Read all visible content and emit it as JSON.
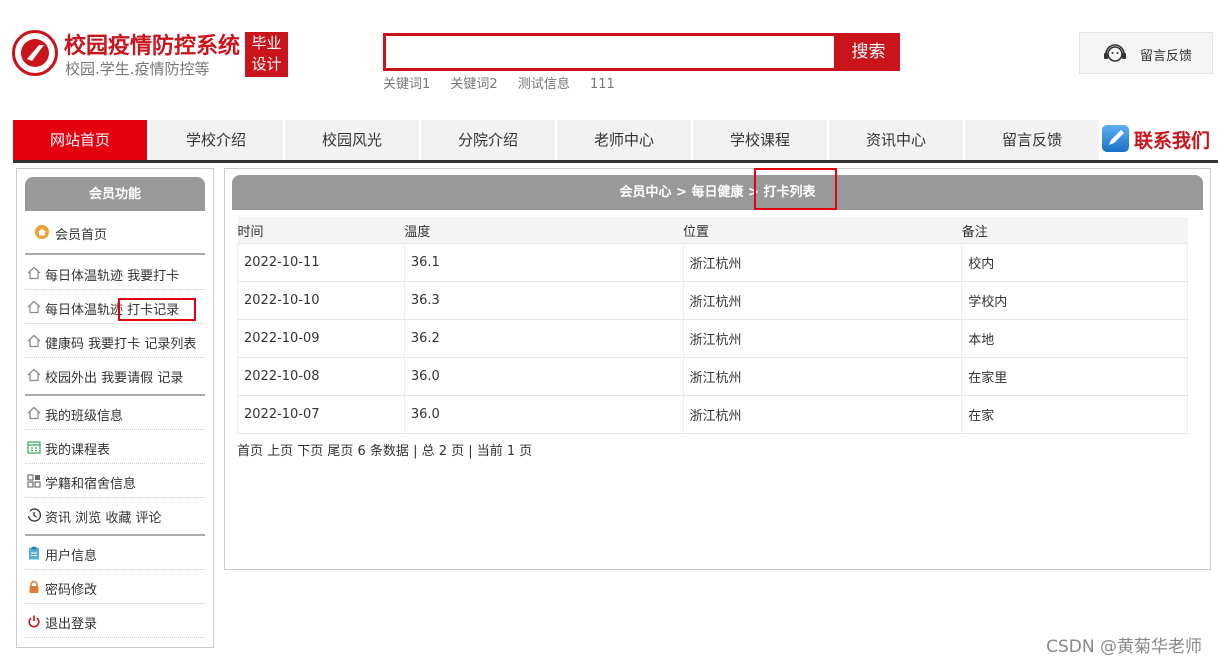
{
  "brand": {
    "title": "校园疫情防控系统",
    "subtitle": "校园.学生.疫情防控等",
    "badge_line1": "毕业",
    "badge_line2": "设计"
  },
  "search": {
    "button": "搜索",
    "placeholder": "",
    "keywords": [
      "关键词1",
      "关键词2",
      "测试信息",
      "111"
    ]
  },
  "feedback": {
    "label": "留言反馈",
    "icon": "headset-icon"
  },
  "nav": {
    "items": [
      "网站首页",
      "学校介绍",
      "校园风光",
      "分院介绍",
      "老师中心",
      "学校课程",
      "资讯中心",
      "留言反馈"
    ],
    "active": 0,
    "contact": "联系我们"
  },
  "sidebar": {
    "title": "会员功能",
    "home": "会员首页",
    "groups": [
      [
        {
          "label": "每日体温轨迹",
          "links": [
            "我要打卡"
          ],
          "icon": "house-icon"
        },
        {
          "label": "每日体温轨迹",
          "links": [
            "打卡记录"
          ],
          "icon": "house-icon"
        },
        {
          "label": "健康码",
          "links": [
            "我要打卡",
            "记录列表"
          ],
          "icon": "house-icon"
        },
        {
          "label": "校园外出",
          "links": [
            "我要请假",
            "记录"
          ],
          "icon": "house-icon"
        }
      ],
      [
        {
          "label": "我的班级信息",
          "links": [],
          "icon": "house-icon"
        },
        {
          "label": "我的课程表",
          "links": [],
          "icon": "calendar-icon"
        },
        {
          "label": "学籍和宿舍信息",
          "links": [],
          "icon": "grid-icon"
        },
        {
          "label": "资讯",
          "links": [
            "浏览",
            "收藏",
            "评论"
          ],
          "icon": "history-icon"
        }
      ],
      [
        {
          "label": "用户信息",
          "links": [],
          "icon": "clipboard-icon"
        },
        {
          "label": "密码修改",
          "links": [],
          "icon": "lock-icon"
        },
        {
          "label": "退出登录",
          "links": [],
          "icon": "power-icon"
        }
      ]
    ]
  },
  "breadcrumb": {
    "part1": "会员中心",
    "sep": ">",
    "part2": "每日健康",
    "current": "打卡列表"
  },
  "table": {
    "headers": [
      "时间",
      "温度",
      "位置",
      "备注"
    ],
    "rows": [
      [
        "2022-10-11",
        "36.1",
        "浙江杭州",
        "校内"
      ],
      [
        "2022-10-10",
        "36.3",
        "浙江杭州",
        "学校内"
      ],
      [
        "2022-10-09",
        "36.2",
        "浙江杭州",
        "本地"
      ],
      [
        "2022-10-08",
        "36.0",
        "浙江杭州",
        "在家里"
      ],
      [
        "2022-10-07",
        "36.0",
        "浙江杭州",
        "在家"
      ]
    ]
  },
  "pager": "首页 上页 下页 尾页 6 条数据 | 总 2 页 | 当前 1 页",
  "watermark": "CSDN @黄菊华老师",
  "colors": {
    "brand_red": "#c9141b",
    "nav_active": "#e3000f",
    "panel_gray": "#999999"
  }
}
